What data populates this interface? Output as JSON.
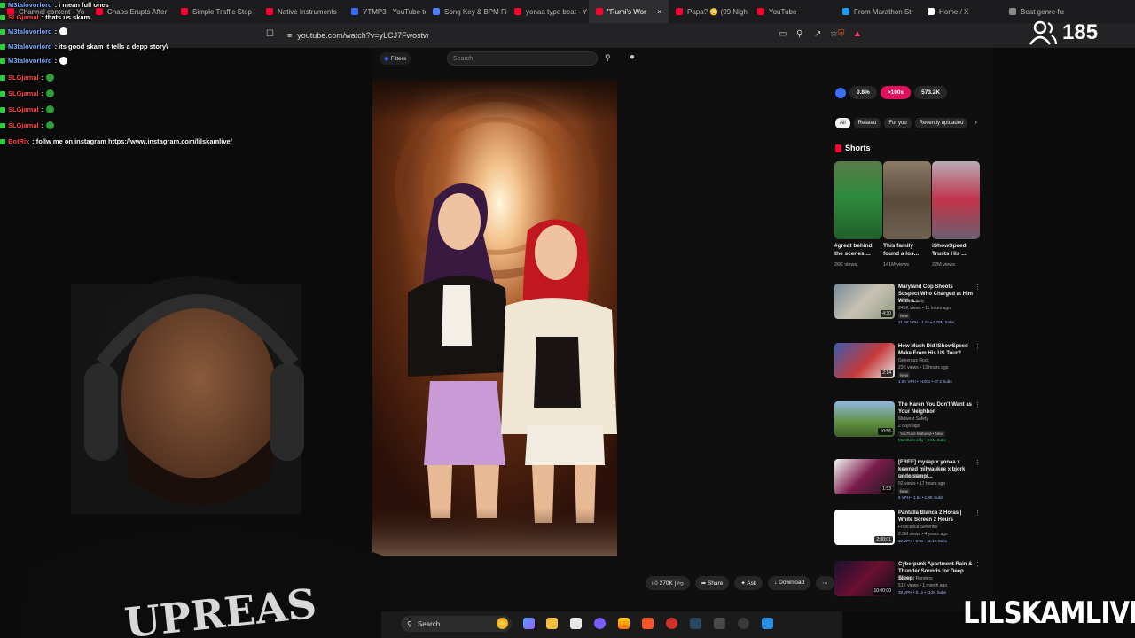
{
  "browser": {
    "tabs": [
      {
        "label": "Channel content - Yo",
        "color": "#ff0033"
      },
      {
        "label": "Chaos Erupts After",
        "color": "#ff0033"
      },
      {
        "label": "Simple Traffic Stop",
        "color": "#ff0033"
      },
      {
        "label": "Native Instruments",
        "color": "#ff0033"
      },
      {
        "label": "YTMP3 - YouTube to",
        "color": "#3b6cff"
      },
      {
        "label": "Song Key & BPM Fi",
        "color": "#4d7cff"
      },
      {
        "label": "yonaa type beat - Y",
        "color": "#ff0033"
      },
      {
        "label": "\"Rumi's Wor",
        "color": "#ff0033",
        "active": true
      },
      {
        "label": "Papa? 😳 (99 Nigh",
        "color": "#ff0033"
      },
      {
        "label": "YouTube",
        "color": "#ff0033"
      },
      {
        "label": "From Marathon Str",
        "color": "#1d9bf0"
      },
      {
        "label": "Home / X",
        "color": "#ffffff"
      },
      {
        "label": "Beat genre fusi",
        "color": "#888888"
      }
    ],
    "url": "youtube.com/watch?v=yLCJ7Fwostw"
  },
  "chat": [
    {
      "user": "M3talovorlord",
      "text": ": i mean full ones",
      "color": "#7aa8ff"
    },
    {
      "user": "SLGjamal",
      "text": ": thats us skam",
      "color": "#ff4444"
    },
    {
      "user": "M3talovorlord",
      "text": ":",
      "color": "#7aa8ff",
      "emote": true
    },
    {
      "user": "M3talovorlord",
      "text": ": its good skam it tells a depp story\\",
      "color": "#7aa8ff"
    },
    {
      "user": "M3talovorlord",
      "text": ":",
      "color": "#7aa8ff",
      "emote": true
    },
    {
      "user": "SLGjamal",
      "text": ":",
      "color": "#ff4444",
      "emote": true
    },
    {
      "user": "SLGjamal",
      "text": ":",
      "color": "#ff4444",
      "emote": true
    },
    {
      "user": "SLGjamal",
      "text": ":",
      "color": "#ff4444",
      "emote": true
    },
    {
      "user": "SLGjamal",
      "text": ":",
      "color": "#ff4444",
      "emote": true
    },
    {
      "user": "BotRix",
      "text": ": follw me on instagram https://www.instagram.com/lilskamlive/",
      "color": "#ff4444"
    }
  ],
  "yt": {
    "search_placeholder": "Search",
    "filters_label": "Filters",
    "actions": [
      "270K",
      "Share",
      "Ask",
      "Download"
    ],
    "stats": [
      "0.8%",
      ">100x",
      "573.2K"
    ],
    "chips": [
      "All",
      "Related",
      "For you",
      "Recently uploaded"
    ],
    "shorts_title": "Shorts",
    "shorts": [
      {
        "title": "#great behind the scenes ...",
        "views": "26K views"
      },
      {
        "title": "This family found a los...",
        "views": "141M views"
      },
      {
        "title": "iShowSpeed Trusts His ...",
        "views": "22M views"
      }
    ],
    "related": [
      {
        "title": "Maryland Cop Shoots Suspect Who Charged at Him With a...",
        "channel": "PoliceActivity",
        "meta": "245K views • 11 hours ago",
        "tag": "New",
        "sub": "21.9K VPH • 1.5x • 4.78M Subs",
        "duration": "4:30"
      },
      {
        "title": "How Much Did IShowSpeed Make From His US Tour?",
        "channel": "Generous Rock",
        "meta": "23K views • 13 hours ago",
        "tag": "New",
        "sub": "1.8K VPH • >100x • 47.2 Subs",
        "duration": "2:14"
      },
      {
        "title": "The Karen You Don't Want as Your Neighbor",
        "channel": "Midwest Safety",
        "meta": "2 days ago",
        "tag": "YouTube featured • New",
        "sub": "Members only • 2.9M Subs",
        "duration": "10:56"
      },
      {
        "title": "[FREE] mysap x yonaa x kewned milwaukee x bjork undo sampl...",
        "channel": "Prod.Lil Skam",
        "meta": "92 views • 17 hours ago",
        "tag": "New",
        "sub": "5 VPH • 1.5x • 1.8K Subs",
        "duration": "1:53"
      },
      {
        "title": "Pantalla Blanca 2 Horas | White Screen 2 Hours",
        "channel": "Francesca Seventor",
        "meta": "2.3M views • 4 years ago",
        "tag": "",
        "sub": "22 VPH • 0.9x • 11.1K Subs",
        "duration": "2:00:01"
      },
      {
        "title": "Cyberpunk Apartment Rain & Thunder Sounds for Deep Sleep",
        "channel": "Ambient Renders",
        "meta": "51K views • 1 month ago",
        "tag": "",
        "sub": "38 VPH • 0.1x • 112K Subs",
        "duration": "10:00:00"
      }
    ]
  },
  "taskbar": {
    "search": "Search"
  },
  "overlay": {
    "viewers": "185",
    "brand": "LILSKAMLIVE",
    "shirt_text": "UPREAS"
  },
  "colors": {
    "yt_red": "#ff0033",
    "bg": "#0f0f0f"
  }
}
